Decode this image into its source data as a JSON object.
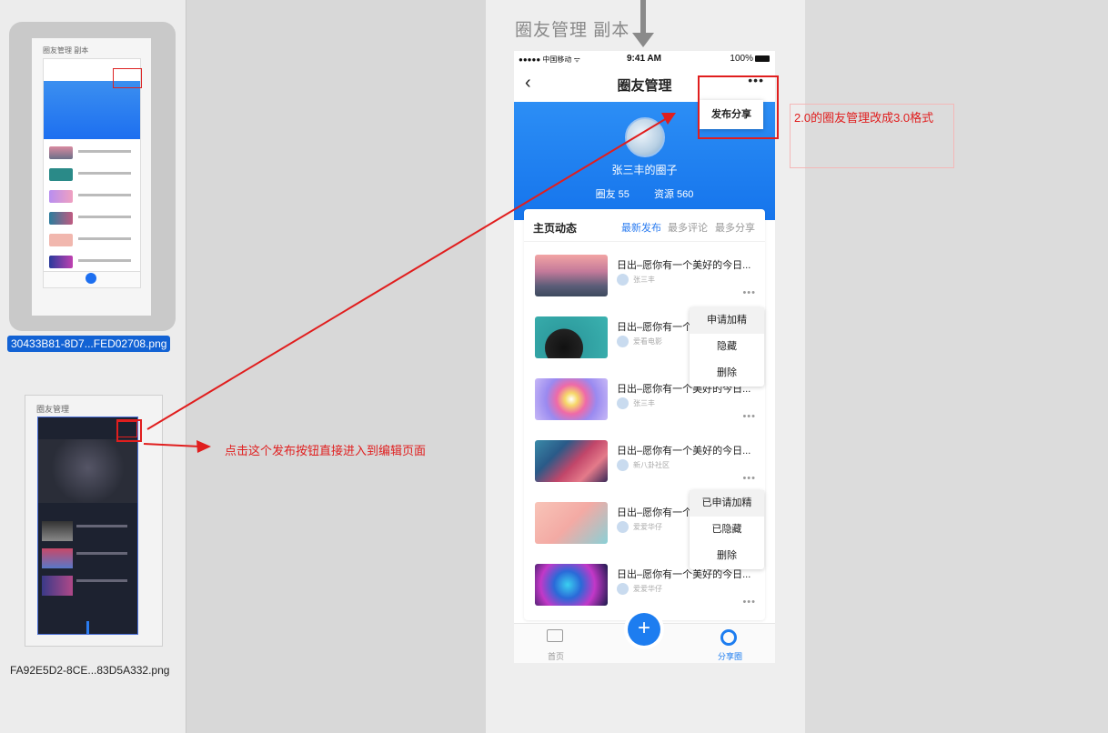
{
  "sidebar": {
    "file1": "30433B81-8D7...FED02708.png",
    "file2": "FA92E5D2-8CE...83D5A332.png",
    "thumb1_title": "圈友管理 副本",
    "thumb2_title": "圈友管理"
  },
  "frame_title": "圈友管理 副本",
  "status": {
    "carrier": "●●●●● 中国移动 ᯤ",
    "time": "9:41 AM",
    "battery": "100%"
  },
  "nav": {
    "back": "‹",
    "title": "圈友管理",
    "more": "•••"
  },
  "hero": {
    "name": "张三丰的圈子",
    "members": "圈友 55",
    "resources": "资源 560"
  },
  "tabs": {
    "main": "主页动态",
    "latest": "最新发布",
    "comments": "最多评论",
    "shares": "最多分享"
  },
  "feed": [
    {
      "title": "日出–愿你有一个美好的今日...",
      "author": "张三丰"
    },
    {
      "title": "日出–愿你有一个美好的今日...",
      "author": "爱看电影"
    },
    {
      "title": "日出–愿你有一个美好的今日...",
      "author": "张三丰"
    },
    {
      "title": "日出–愿你有一个美好的今日...",
      "author": "新八卦社区"
    },
    {
      "title": "日出–愿你有一个美好的今日...",
      "author": "爱爱华仔"
    },
    {
      "title": "日出–愿你有一个美好的今日...",
      "author": "爱爱华仔"
    }
  ],
  "more_dots": "•••",
  "menu1": [
    "申请加精",
    "隐藏",
    "删除"
  ],
  "menu2": [
    "已申请加精",
    "已隐藏",
    "删除"
  ],
  "publish": "发布分享",
  "tabbar": {
    "home": "首页",
    "plus": "+",
    "share": "分享圈"
  },
  "annotations": {
    "right": "2.0的圈友管理改成3.0格式",
    "left": "点击这个发布按钮直接进入到编辑页面"
  },
  "colors": {
    "accent": "#1d7df0",
    "annotation": "#e01e1e"
  }
}
